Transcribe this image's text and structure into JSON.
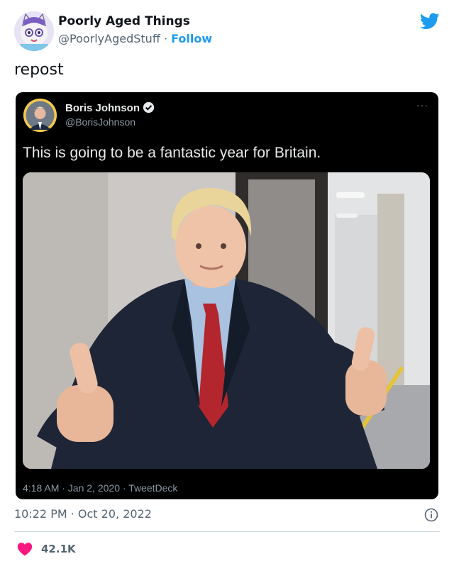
{
  "author": {
    "name": "Poorly Aged Things",
    "handle": "@PoorlyAgedStuff",
    "separator": "·",
    "follow_label": "Follow",
    "avatar_icon": "cartoon-cat-avatar"
  },
  "brand": {
    "icon": "twitter-bird-icon",
    "color": "#1d9bf0"
  },
  "tweet": {
    "text": "repost"
  },
  "embedded_tweet": {
    "name": "Boris Johnson",
    "handle": "@BorisJohnson",
    "verified_icon": "verified-badge-icon",
    "more_icon": "···",
    "text": "This is going to be a fantastic year for Britain.",
    "photo_icon": "man-giving-thumbs-up-photo",
    "meta": "4:18 AM · Jan 2, 2020 · TweetDeck"
  },
  "footer": {
    "timestamp": "10:22 PM · Oct 20, 2022",
    "info_icon": "info-icon",
    "like_icon": "heart-icon",
    "like_count": "42.1K",
    "like_color": "#f91880"
  }
}
